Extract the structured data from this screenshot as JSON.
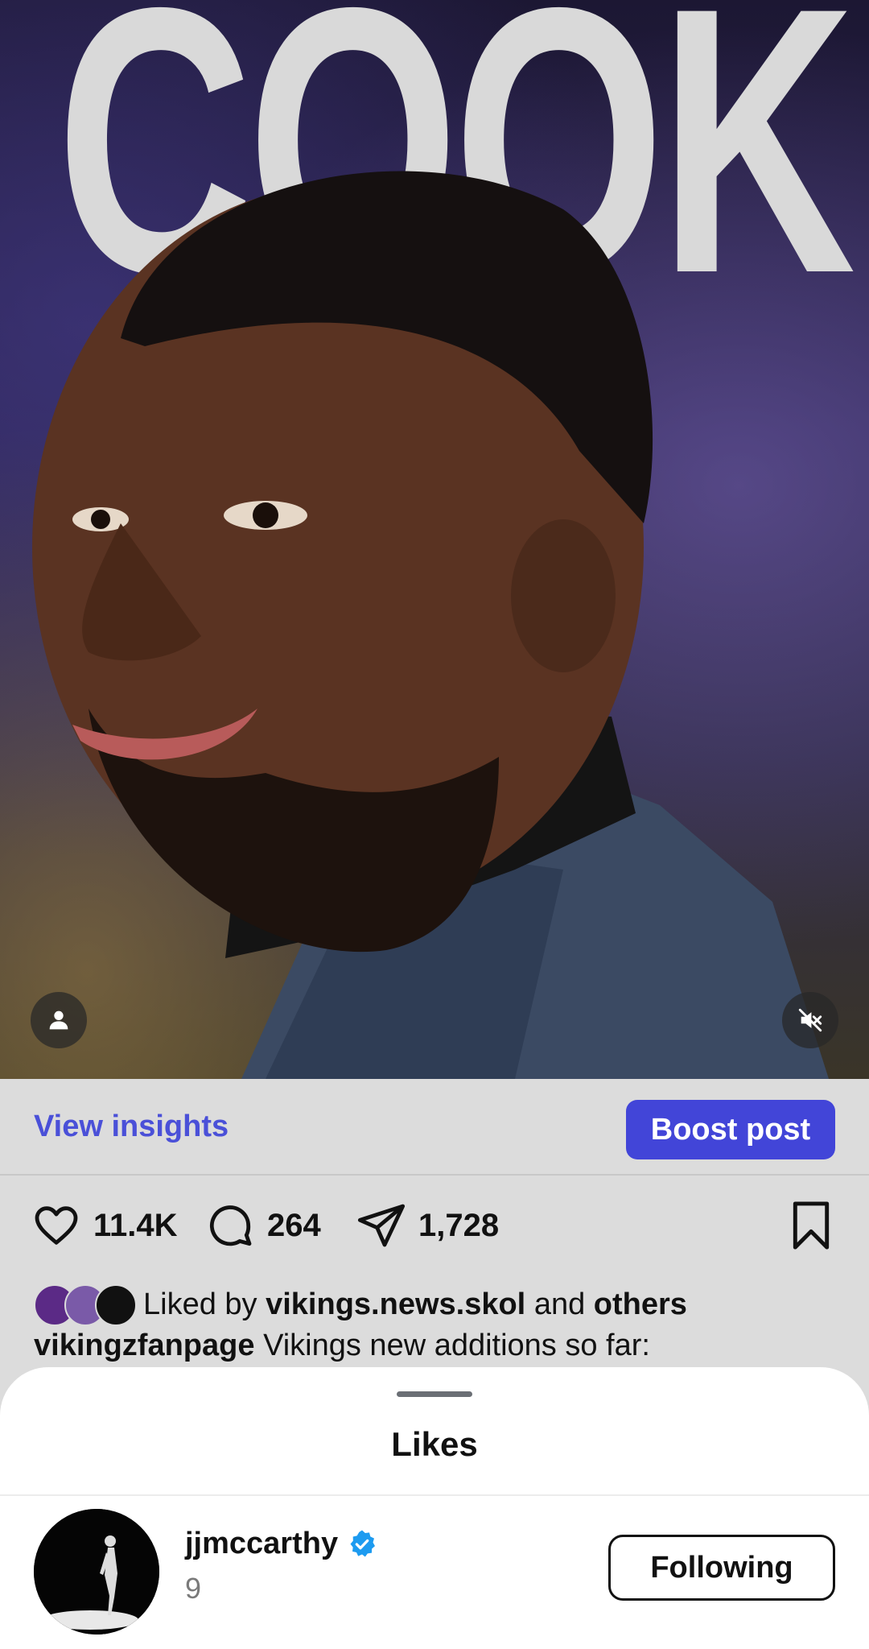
{
  "post": {
    "cover_text": "COOK"
  },
  "actions": {
    "insights_label": "View insights",
    "boost_label": "Boost post"
  },
  "stats": {
    "likes": "11.4K",
    "comments": "264",
    "shares": "1,728"
  },
  "liked_by": {
    "prefix": "Liked by",
    "user": "vikings.news.skol",
    "middle": "and",
    "others": "others"
  },
  "caption": {
    "user": "vikingzfanpage",
    "text": "Vikings new additions so far:"
  },
  "sheet": {
    "title": "Likes",
    "items": [
      {
        "username": "jjmccarthy",
        "subtitle": "9",
        "verified": true,
        "button_label": "Following"
      }
    ]
  },
  "colors": {
    "accent": "#4245d8",
    "link": "#4a50d8",
    "verified": "#1d9bf0"
  },
  "icons": [
    "user-tag-icon",
    "muted-speaker-icon",
    "heart-icon",
    "comment-icon",
    "share-icon",
    "bookmark-icon",
    "verified-badge-icon"
  ]
}
